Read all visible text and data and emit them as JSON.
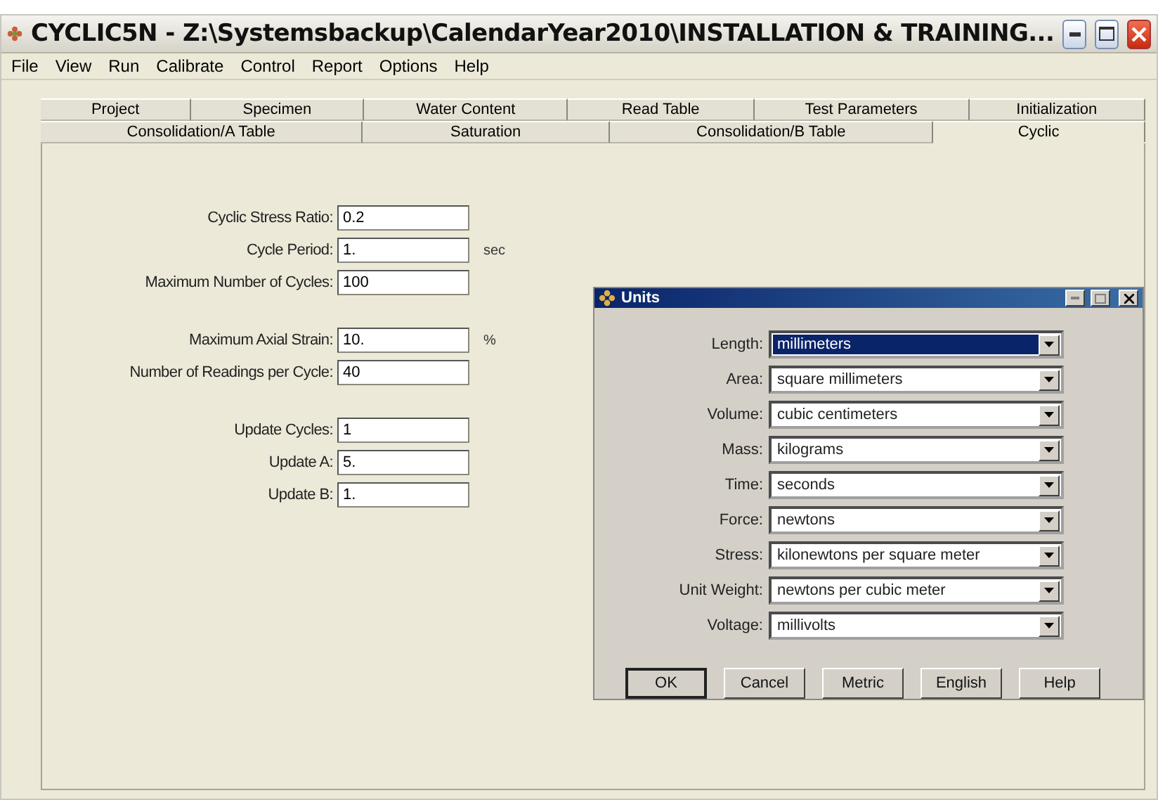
{
  "window": {
    "title": "CYCLIC5N - Z:\\Systemsbackup\\CalendarYear2010\\INSTALLATION & TRAINING..."
  },
  "menu": [
    "File",
    "View",
    "Run",
    "Calibrate",
    "Control",
    "Report",
    "Options",
    "Help"
  ],
  "tab_rows": [
    [
      {
        "label": "Project",
        "selected": false
      },
      {
        "label": "Specimen",
        "selected": false
      },
      {
        "label": "Water Content",
        "selected": false
      },
      {
        "label": "Read Table",
        "selected": false
      },
      {
        "label": "Test Parameters",
        "selected": false
      },
      {
        "label": "Initialization",
        "selected": false
      }
    ],
    [
      {
        "label": "Consolidation/A Table",
        "selected": false
      },
      {
        "label": "Saturation",
        "selected": false
      },
      {
        "label": "Consolidation/B Table",
        "selected": false
      },
      {
        "label": "Cyclic",
        "selected": true
      }
    ]
  ],
  "form_groups": [
    [
      {
        "label": "Cyclic Stress Ratio:",
        "value": "0.2"
      },
      {
        "label": "Cycle Period:",
        "value": "1.",
        "unit": "sec"
      },
      {
        "label": "Maximum Number of Cycles:",
        "value": "100"
      }
    ],
    [
      {
        "label": "Maximum Axial Strain:",
        "value": "10.",
        "unit": "%"
      },
      {
        "label": "Number of Readings per Cycle:",
        "value": "40"
      }
    ],
    [
      {
        "label": "Update Cycles:",
        "value": "1"
      },
      {
        "label": "Update A:",
        "value": "5."
      },
      {
        "label": "Update B:",
        "value": "1."
      }
    ]
  ],
  "units_dialog": {
    "title": "Units",
    "fields": [
      {
        "label": "Length:",
        "value": "millimeters",
        "focused": true
      },
      {
        "label": "Area:",
        "value": "square millimeters",
        "focused": false
      },
      {
        "label": "Volume:",
        "value": "cubic centimeters",
        "focused": false
      },
      {
        "label": "Mass:",
        "value": "kilograms",
        "focused": false
      },
      {
        "label": "Time:",
        "value": "seconds",
        "focused": false
      },
      {
        "label": "Force:",
        "value": "newtons",
        "focused": false
      },
      {
        "label": "Stress:",
        "value": "kilonewtons per square meter",
        "focused": false
      },
      {
        "label": "Unit Weight:",
        "value": "newtons per cubic meter",
        "focused": false
      },
      {
        "label": "Voltage:",
        "value": "millivolts",
        "focused": false
      }
    ],
    "buttons": [
      {
        "label": "OK",
        "default": true
      },
      {
        "label": "Cancel",
        "default": false
      },
      {
        "label": "Metric",
        "default": false
      },
      {
        "label": "English",
        "default": false
      },
      {
        "label": "Help",
        "default": false
      }
    ]
  }
}
